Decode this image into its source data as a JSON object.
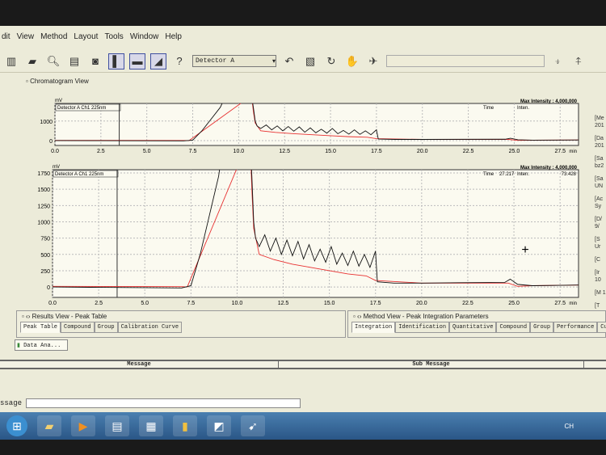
{
  "menu": [
    "dit",
    "View",
    "Method",
    "Layout",
    "Tools",
    "Window",
    "Help"
  ],
  "toolbar": {
    "detector_select": "Detector A",
    "help": "?"
  },
  "chromatogram_view": {
    "title": "Chromatogram View"
  },
  "right_info": [
    "[Me 201",
    "[Da 201",
    "[Sa bz2",
    "[Sa UN",
    "[Ac Sy",
    "[D/ 9/",
    "[S Ur",
    "[C",
    "[Ir 10",
    "[M 1",
    "[T"
  ],
  "results_view": {
    "title": "Results View - Peak Table",
    "tabs": [
      "Peak Table",
      "Compound",
      "Group",
      "Calibration Curve"
    ],
    "doc_tab": "Data Ana..."
  },
  "method_view": {
    "title": "Method View - Peak Integration Parameters",
    "tabs": [
      "Integration",
      "Identification",
      "Quantitative",
      "Compound",
      "Group",
      "Performance",
      "Custo"
    ]
  },
  "messages": {
    "col1": "Message",
    "col2": "Sub Message",
    "label": "ssage"
  },
  "taskbar": {
    "lang": "CH"
  },
  "chart_data": [
    {
      "type": "line",
      "title": "Detector A Ch1 225nm",
      "ylabel": "mV",
      "xlabel": "min",
      "max_intensity": "Max Intensity : 4,000,000",
      "time_label": "Time",
      "inten_label": "Inten.",
      "time_value": "",
      "inten_value": "",
      "xlim": [
        0,
        28.5
      ],
      "ylim": [
        -250,
        1900
      ],
      "xticks": [
        "0.0",
        "2.5",
        "5.0",
        "7.5",
        "10.0",
        "12.5",
        "15.0",
        "17.5",
        "20.0",
        "22.5",
        "25.0",
        "27.5"
      ],
      "yticks": [
        "0",
        "1000"
      ]
    },
    {
      "type": "line",
      "title": "Detector A Ch1 225nm",
      "ylabel": "mV",
      "xlabel": "min",
      "max_intensity": "Max Intensity : 4,000,000",
      "time_label": "Time",
      "inten_label": "Inten.",
      "time_value": "27.217",
      "inten_value": "73.428",
      "xlim": [
        0,
        28.5
      ],
      "ylim": [
        -160,
        1800
      ],
      "xticks": [
        "0.0",
        "2.5",
        "5.0",
        "7.5",
        "10.0",
        "12.5",
        "15.0",
        "17.5",
        "20.0",
        "22.5",
        "25.0",
        "27.5"
      ],
      "yticks": [
        "0",
        "250",
        "500",
        "750",
        "1000",
        "1250",
        "1500",
        "1750"
      ]
    }
  ],
  "series": [
    {
      "name": "signal",
      "color": "#111111",
      "points": [
        [
          0,
          0
        ],
        [
          2,
          -5
        ],
        [
          5,
          -10
        ],
        [
          7,
          -15
        ],
        [
          7.5,
          20
        ],
        [
          8,
          500
        ],
        [
          8.5,
          1100
        ],
        [
          9,
          1700
        ],
        [
          9.3,
          2300
        ],
        [
          10.7,
          2300
        ],
        [
          10.8,
          1700
        ],
        [
          10.9,
          1000
        ],
        [
          11.0,
          750
        ],
        [
          11.2,
          620
        ],
        [
          11.5,
          800
        ],
        [
          11.8,
          550
        ],
        [
          12.1,
          750
        ],
        [
          12.4,
          500
        ],
        [
          12.7,
          720
        ],
        [
          13.0,
          480
        ],
        [
          13.3,
          700
        ],
        [
          13.6,
          430
        ],
        [
          13.9,
          650
        ],
        [
          14.2,
          400
        ],
        [
          14.5,
          580
        ],
        [
          14.8,
          380
        ],
        [
          15.1,
          620
        ],
        [
          15.4,
          350
        ],
        [
          15.7,
          520
        ],
        [
          16.0,
          330
        ],
        [
          16.3,
          550
        ],
        [
          16.6,
          320
        ],
        [
          16.9,
          500
        ],
        [
          17.2,
          300
        ],
        [
          17.5,
          550
        ],
        [
          17.6,
          80
        ],
        [
          18.5,
          60
        ],
        [
          20,
          60
        ],
        [
          22,
          65
        ],
        [
          24.5,
          70
        ],
        [
          24.8,
          120
        ],
        [
          25.2,
          40
        ],
        [
          26,
          20
        ],
        [
          27.5,
          25
        ],
        [
          28.5,
          30
        ]
      ]
    },
    {
      "name": "baseline",
      "color": "#e83030",
      "points": [
        [
          0,
          10
        ],
        [
          7,
          5
        ],
        [
          7.3,
          0
        ],
        [
          10.7,
          2300
        ],
        [
          10.8,
          1500
        ],
        [
          10.9,
          900
        ],
        [
          11.2,
          500
        ],
        [
          12,
          420
        ],
        [
          13,
          350
        ],
        [
          14,
          300
        ],
        [
          15,
          250
        ],
        [
          16,
          200
        ],
        [
          17,
          170
        ],
        [
          17.5,
          100
        ],
        [
          20,
          60
        ],
        [
          24.7,
          60
        ],
        [
          25.2,
          10
        ],
        [
          26,
          20
        ],
        [
          28.5,
          30
        ]
      ]
    }
  ]
}
